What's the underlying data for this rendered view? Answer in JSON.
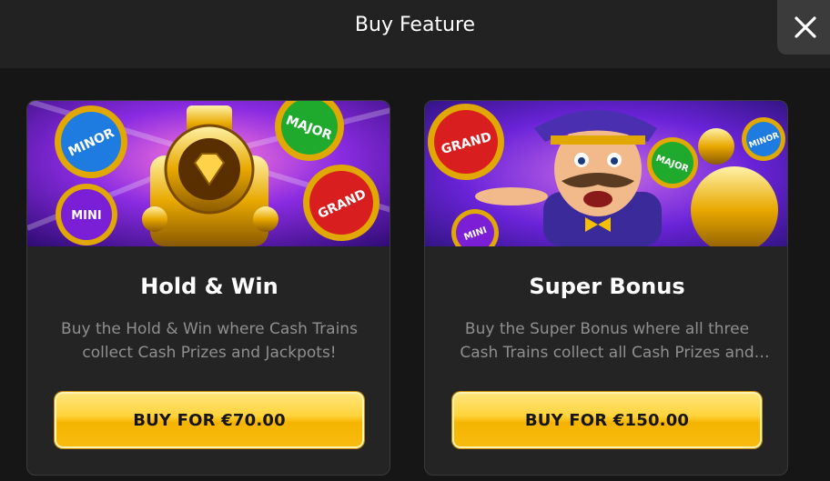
{
  "header": {
    "title": "Buy Feature",
    "close_icon": "close-icon"
  },
  "cards": [
    {
      "title": "Hold & Win",
      "description": "Buy the Hold & Win where Cash Trains collect Cash Prizes and Jackpots!",
      "button_label": "BUY FOR €70.00",
      "art": {
        "badges": [
          "MINOR",
          "MAJOR",
          "MINI",
          "GRAND"
        ]
      }
    },
    {
      "title": "Super Bonus",
      "description": "Buy the Super Bonus where all three Cash Trains collect all Cash Prizes and Jackpots!",
      "button_label": "BUY FOR €150.00",
      "art": {
        "badges": [
          "GRAND",
          "MAJOR",
          "MINOR",
          "MINI"
        ]
      }
    }
  ],
  "colors": {
    "background": "#161616",
    "header": "#222222",
    "card": "#242424",
    "button_gold": "#ffd33a",
    "description_text": "#8f8f8f"
  }
}
